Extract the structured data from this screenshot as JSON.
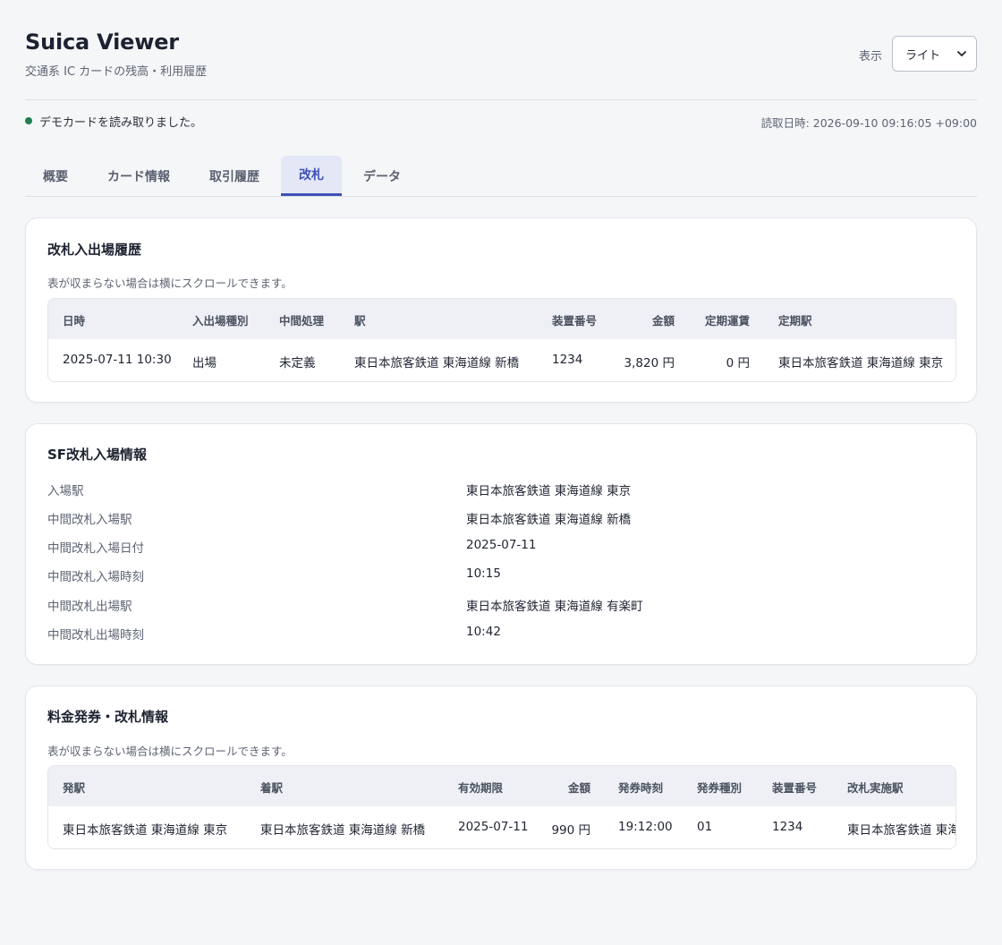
{
  "header": {
    "title": "Suica Viewer",
    "subtitle": "交通系 IC カードの残高・利用履歴",
    "display_label": "表示",
    "display_value": "ライト"
  },
  "status": {
    "message": "デモカードを読み取りました。",
    "read_time": "読取日時: 2026-09-10 09:16:05 +09:00",
    "dot_color": "#1e7f4f"
  },
  "tabs": [
    {
      "label": "概要"
    },
    {
      "label": "カード情報"
    },
    {
      "label": "取引履歴"
    },
    {
      "label": "改札",
      "active": true
    },
    {
      "label": "データ"
    }
  ],
  "gate_history": {
    "title": "改札入出場履歴",
    "note": "表が収まらない場合は横にスクロールできます。",
    "columns": [
      "日時",
      "入出場種別",
      "中間処理",
      "駅",
      "装置番号",
      "金額",
      "定期運賃",
      "定期駅"
    ],
    "rows": [
      [
        "2025-07-11 10:30",
        "出場",
        "未定義",
        "東日本旅客鉄道 東海道線 新橋",
        "1234",
        "3,820 円",
        "0 円",
        "東日本旅客鉄道 東海道線 東京"
      ]
    ]
  },
  "sf_entry": {
    "title": "SF改札入場情報",
    "items": [
      {
        "key": "入場駅",
        "value": "東日本旅客鉄道 東海道線 東京"
      },
      {
        "key": "中間改札入場駅",
        "value": "東日本旅客鉄道 東海道線 新橋"
      },
      {
        "key": "中間改札入場日付",
        "value": "2025-07-11"
      },
      {
        "key": "中間改札入場時刻",
        "value": "10:15"
      },
      {
        "key": "中間改札出場駅",
        "value": "東日本旅客鉄道 東海道線 有楽町"
      },
      {
        "key": "中間改札出場時刻",
        "value": "10:42"
      }
    ]
  },
  "fare_ticket": {
    "title": "料金発券・改札情報",
    "note": "表が収まらない場合は横にスクロールできます。",
    "columns": [
      "発駅",
      "着駅",
      "有効期限",
      "金額",
      "発券時刻",
      "発券種別",
      "装置番号",
      "改札実施駅"
    ],
    "rows": [
      [
        "東日本旅客鉄道 東海道線 東京",
        "東日本旅客鉄道 東海道線 新橋",
        "2025-07-11",
        "990 円",
        "19:12:00",
        "01",
        "1234",
        "東日本旅客鉄道 東海道線 東京"
      ]
    ]
  },
  "colors": {
    "accent": "#3f51b5",
    "tab_active_bg": "#e3e7f6",
    "table_header_bg": "#eef0f5"
  }
}
